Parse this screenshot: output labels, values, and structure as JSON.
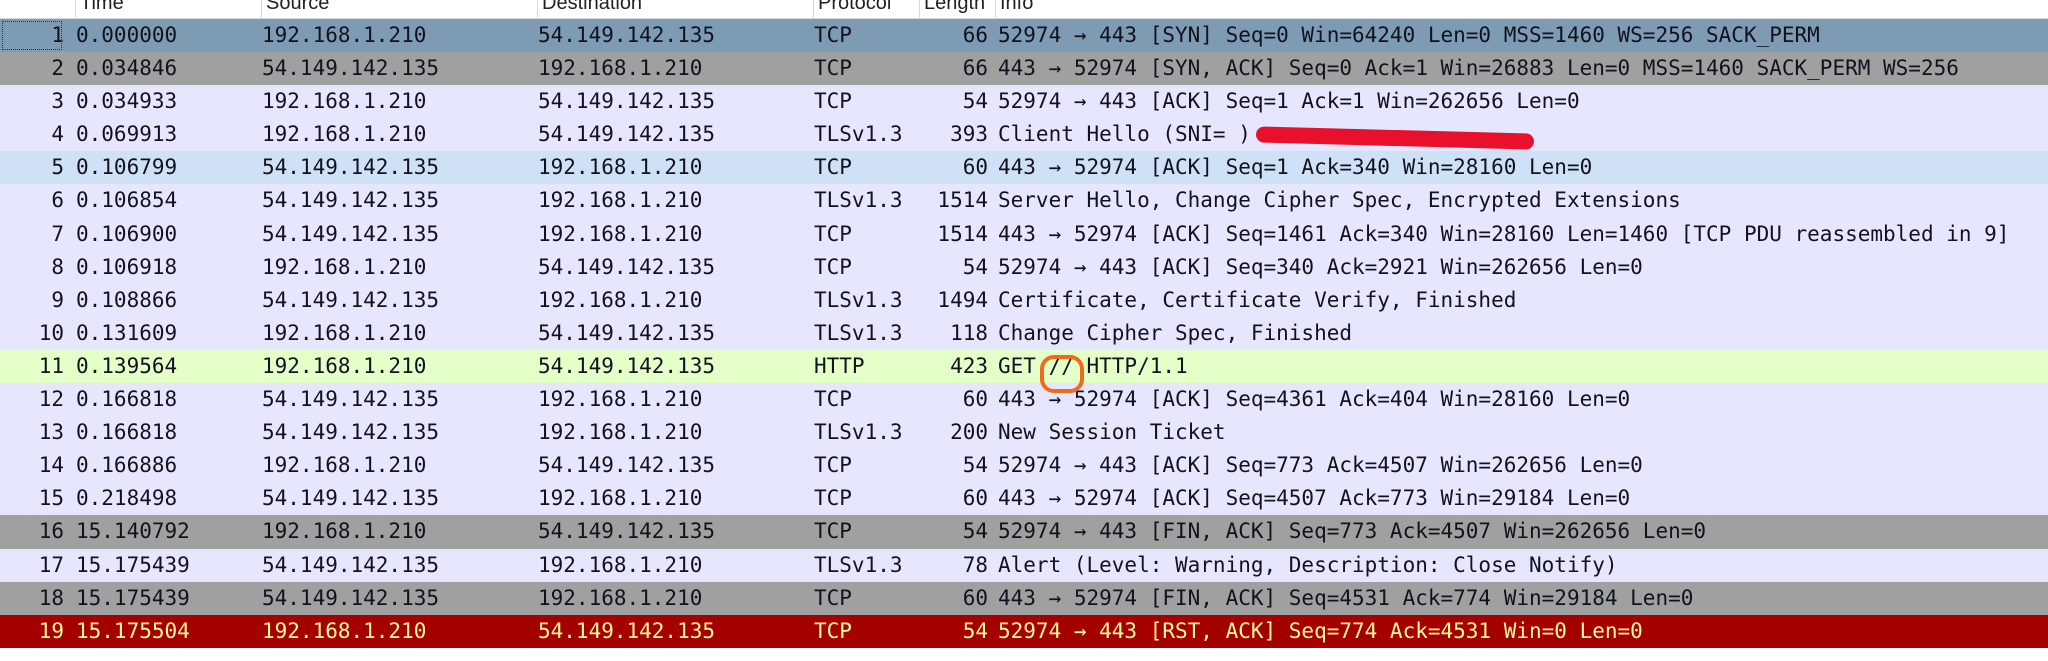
{
  "columns": {
    "no": "",
    "time": "Time",
    "source": "Source",
    "destination": "Destination",
    "protocol": "Protocol",
    "length": "Length",
    "info": "Info"
  },
  "rows": [
    {
      "no": "1",
      "time": "0.000000",
      "src": "192.168.1.210",
      "dst": "54.149.142.135",
      "proto": "TCP",
      "len": "66",
      "info": "52974 → 443 [SYN] Seq=0 Win=64240 Len=0 MSS=1460 WS=256 SACK_PERM",
      "bg": "#7d9bb3",
      "fg": "#12121f"
    },
    {
      "no": "2",
      "time": "0.034846",
      "src": "54.149.142.135",
      "dst": "192.168.1.210",
      "proto": "TCP",
      "len": "66",
      "info": "443 → 52974 [SYN, ACK] Seq=0 Ack=1 Win=26883 Len=0 MSS=1460 SACK_PERM WS=256",
      "bg": "#a0a0a0",
      "fg": "#12121f"
    },
    {
      "no": "3",
      "time": "0.034933",
      "src": "192.168.1.210",
      "dst": "54.149.142.135",
      "proto": "TCP",
      "len": "54",
      "info": "52974 → 443 [ACK] Seq=1 Ack=1 Win=262656 Len=0",
      "bg": "#e7e6ff",
      "fg": "#12121f"
    },
    {
      "no": "4",
      "time": "0.069913",
      "src": "192.168.1.210",
      "dst": "54.149.142.135",
      "proto": "TLSv1.3",
      "len": "393",
      "info": "Client Hello (SNI=                    )",
      "bg": "#e7e6ff",
      "fg": "#12121f"
    },
    {
      "no": "5",
      "time": "0.106799",
      "src": "54.149.142.135",
      "dst": "192.168.1.210",
      "proto": "TCP",
      "len": "60",
      "info": "443 → 52974 [ACK] Seq=1 Ack=340 Win=28160 Len=0",
      "bg": "#cfe1f7",
      "fg": "#12121f"
    },
    {
      "no": "6",
      "time": "0.106854",
      "src": "54.149.142.135",
      "dst": "192.168.1.210",
      "proto": "TLSv1.3",
      "len": "1514",
      "info": "Server Hello, Change Cipher Spec, Encrypted Extensions",
      "bg": "#e7e6ff",
      "fg": "#12121f"
    },
    {
      "no": "7",
      "time": "0.106900",
      "src": "54.149.142.135",
      "dst": "192.168.1.210",
      "proto": "TCP",
      "len": "1514",
      "info": "443 → 52974 [ACK] Seq=1461 Ack=340 Win=28160 Len=1460 [TCP PDU reassembled in 9]",
      "bg": "#e7e6ff",
      "fg": "#12121f"
    },
    {
      "no": "8",
      "time": "0.106918",
      "src": "192.168.1.210",
      "dst": "54.149.142.135",
      "proto": "TCP",
      "len": "54",
      "info": "52974 → 443 [ACK] Seq=340 Ack=2921 Win=262656 Len=0",
      "bg": "#e7e6ff",
      "fg": "#12121f"
    },
    {
      "no": "9",
      "time": "0.108866",
      "src": "54.149.142.135",
      "dst": "192.168.1.210",
      "proto": "TLSv1.3",
      "len": "1494",
      "info": "Certificate, Certificate Verify, Finished",
      "bg": "#e7e6ff",
      "fg": "#12121f"
    },
    {
      "no": "10",
      "time": "0.131609",
      "src": "192.168.1.210",
      "dst": "54.149.142.135",
      "proto": "TLSv1.3",
      "len": "118",
      "info": "Change Cipher Spec, Finished",
      "bg": "#e7e6ff",
      "fg": "#12121f"
    },
    {
      "no": "11",
      "time": "0.139564",
      "src": "192.168.1.210",
      "dst": "54.149.142.135",
      "proto": "HTTP",
      "len": "423",
      "info": "GET // HTTP/1.1",
      "bg": "#e4ffc7",
      "fg": "#12121f"
    },
    {
      "no": "12",
      "time": "0.166818",
      "src": "54.149.142.135",
      "dst": "192.168.1.210",
      "proto": "TCP",
      "len": "60",
      "info": "443 → 52974 [ACK] Seq=4361 Ack=404 Win=28160 Len=0",
      "bg": "#e7e6ff",
      "fg": "#12121f"
    },
    {
      "no": "13",
      "time": "0.166818",
      "src": "54.149.142.135",
      "dst": "192.168.1.210",
      "proto": "TLSv1.3",
      "len": "200",
      "info": "New Session Ticket",
      "bg": "#e7e6ff",
      "fg": "#12121f"
    },
    {
      "no": "14",
      "time": "0.166886",
      "src": "192.168.1.210",
      "dst": "54.149.142.135",
      "proto": "TCP",
      "len": "54",
      "info": "52974 → 443 [ACK] Seq=773 Ack=4507 Win=262656 Len=0",
      "bg": "#e7e6ff",
      "fg": "#12121f"
    },
    {
      "no": "15",
      "time": "0.218498",
      "src": "54.149.142.135",
      "dst": "192.168.1.210",
      "proto": "TCP",
      "len": "60",
      "info": "443 → 52974 [ACK] Seq=4507 Ack=773 Win=29184 Len=0",
      "bg": "#e7e6ff",
      "fg": "#12121f"
    },
    {
      "no": "16",
      "time": "15.140792",
      "src": "192.168.1.210",
      "dst": "54.149.142.135",
      "proto": "TCP",
      "len": "54",
      "info": "52974 → 443 [FIN, ACK] Seq=773 Ack=4507 Win=262656 Len=0",
      "bg": "#a0a0a0",
      "fg": "#12121f"
    },
    {
      "no": "17",
      "time": "15.175439",
      "src": "54.149.142.135",
      "dst": "192.168.1.210",
      "proto": "TLSv1.3",
      "len": "78",
      "info": "Alert (Level: Warning, Description: Close Notify)",
      "bg": "#e7e6ff",
      "fg": "#12121f"
    },
    {
      "no": "18",
      "time": "15.175439",
      "src": "54.149.142.135",
      "dst": "192.168.1.210",
      "proto": "TCP",
      "len": "60",
      "info": "443 → 52974 [FIN, ACK] Seq=4531 Ack=774 Win=29184 Len=0",
      "bg": "#a0a0a0",
      "fg": "#12121f"
    },
    {
      "no": "19",
      "time": "15.175504",
      "src": "192.168.1.210",
      "dst": "54.149.142.135",
      "proto": "TCP",
      "len": "54",
      "info": "52974 → 443 [RST, ACK] Seq=774 Ack=4531 Win=0 Len=0",
      "bg": "#a40000",
      "fg": "#fffc9c"
    }
  ],
  "selected_row": 1
}
